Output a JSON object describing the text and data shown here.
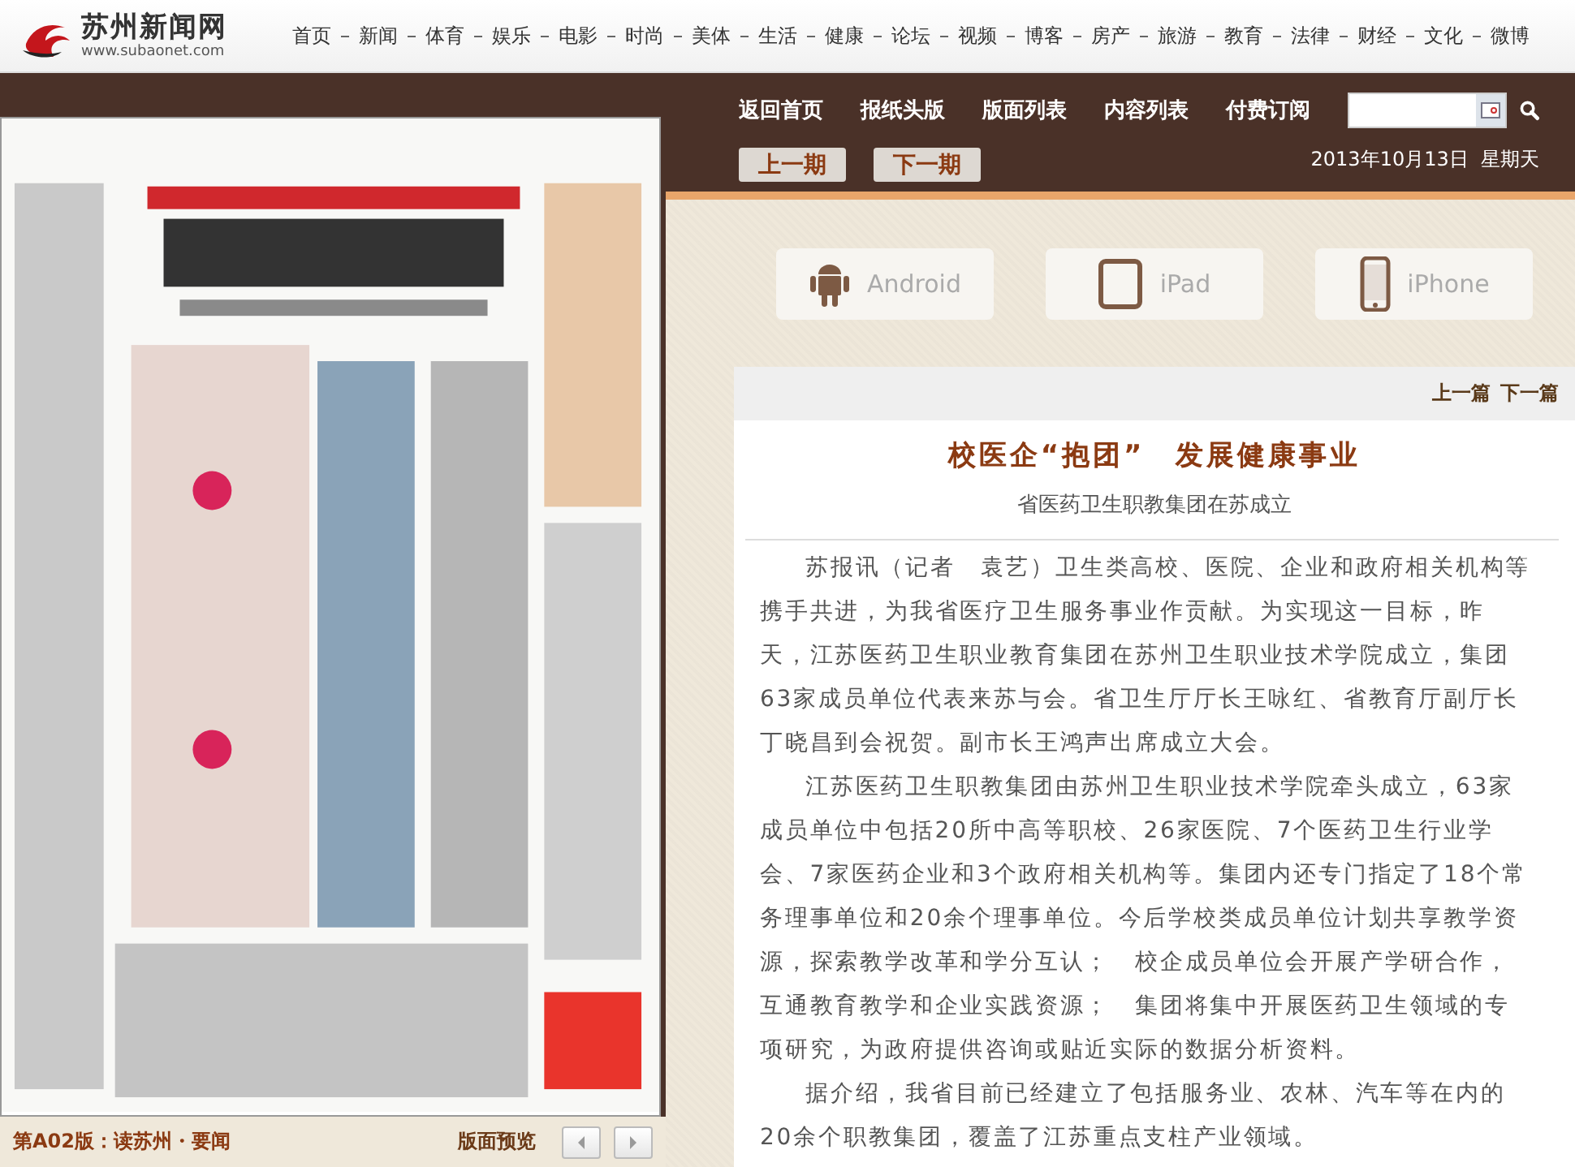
{
  "site": {
    "name": "苏州新闻网",
    "url": "www.subaonet.com"
  },
  "channels": [
    "首页",
    "新闻",
    "体育",
    "娱乐",
    "电影",
    "时尚",
    "美体",
    "生活",
    "健康",
    "论坛",
    "视频",
    "博客",
    "房产",
    "旅游",
    "教育",
    "法律",
    "财经",
    "文化",
    "微博"
  ],
  "paper_nav": {
    "links": [
      "返回首页",
      "报纸头版",
      "版面列表",
      "内容列表",
      "付费订阅"
    ],
    "issue_buttons": [
      "上一期",
      "下一期"
    ],
    "date": "2013年10月13日  星期天"
  },
  "page_viewer": {
    "page_label": "第A02版：读苏州・要闻",
    "preview_label": "版面预览"
  },
  "apps": [
    {
      "kind": "android",
      "label": "Android"
    },
    {
      "kind": "tablet",
      "label": "iPad"
    },
    {
      "kind": "phone",
      "label": "iPhone"
    }
  ],
  "article": {
    "nav": [
      "上一篇",
      "下一篇"
    ],
    "title": "校医企“抱团”　发展健康事业",
    "subtitle": "省医药卫生职教集团在苏成立",
    "paragraphs": [
      "苏报讯（记者　袁艺）卫生类高校、医院、企业和政府相关机构等携手共进，为我省医疗卫生服务事业作贡献。为实现这一目标，昨天，江苏医药卫生职业教育集团在苏州卫生职业技术学院成立，集团63家成员单位代表来苏与会。省卫生厅厅长王咏红、省教育厅副厅长丁晓昌到会祝贺。副市长王鸿声出席成立大会。",
      "江苏医药卫生职教集团由苏州卫生职业技术学院牵头成立，63家成员单位中包括20所中高等职校、26家医院、7个医药卫生行业学会、7家医药企业和3个政府相关机构等。集团内还专门指定了18个常务理事单位和20余个理事单位。今后学校类成员单位计划共享教学资源，探索教学改革和学分互认；　校企成员单位会开展产学研合作，互通教育教学和企业实践资源；　集团将集中开展医药卫生领域的专项研究，为政府提供咨询或贴近实际的数据分析资料。",
      "据介绍，我省目前已经建立了包括服务业、农林、汽车等在内的20余个职教集团，覆盖了江苏重点支柱产业领域。"
    ]
  }
}
